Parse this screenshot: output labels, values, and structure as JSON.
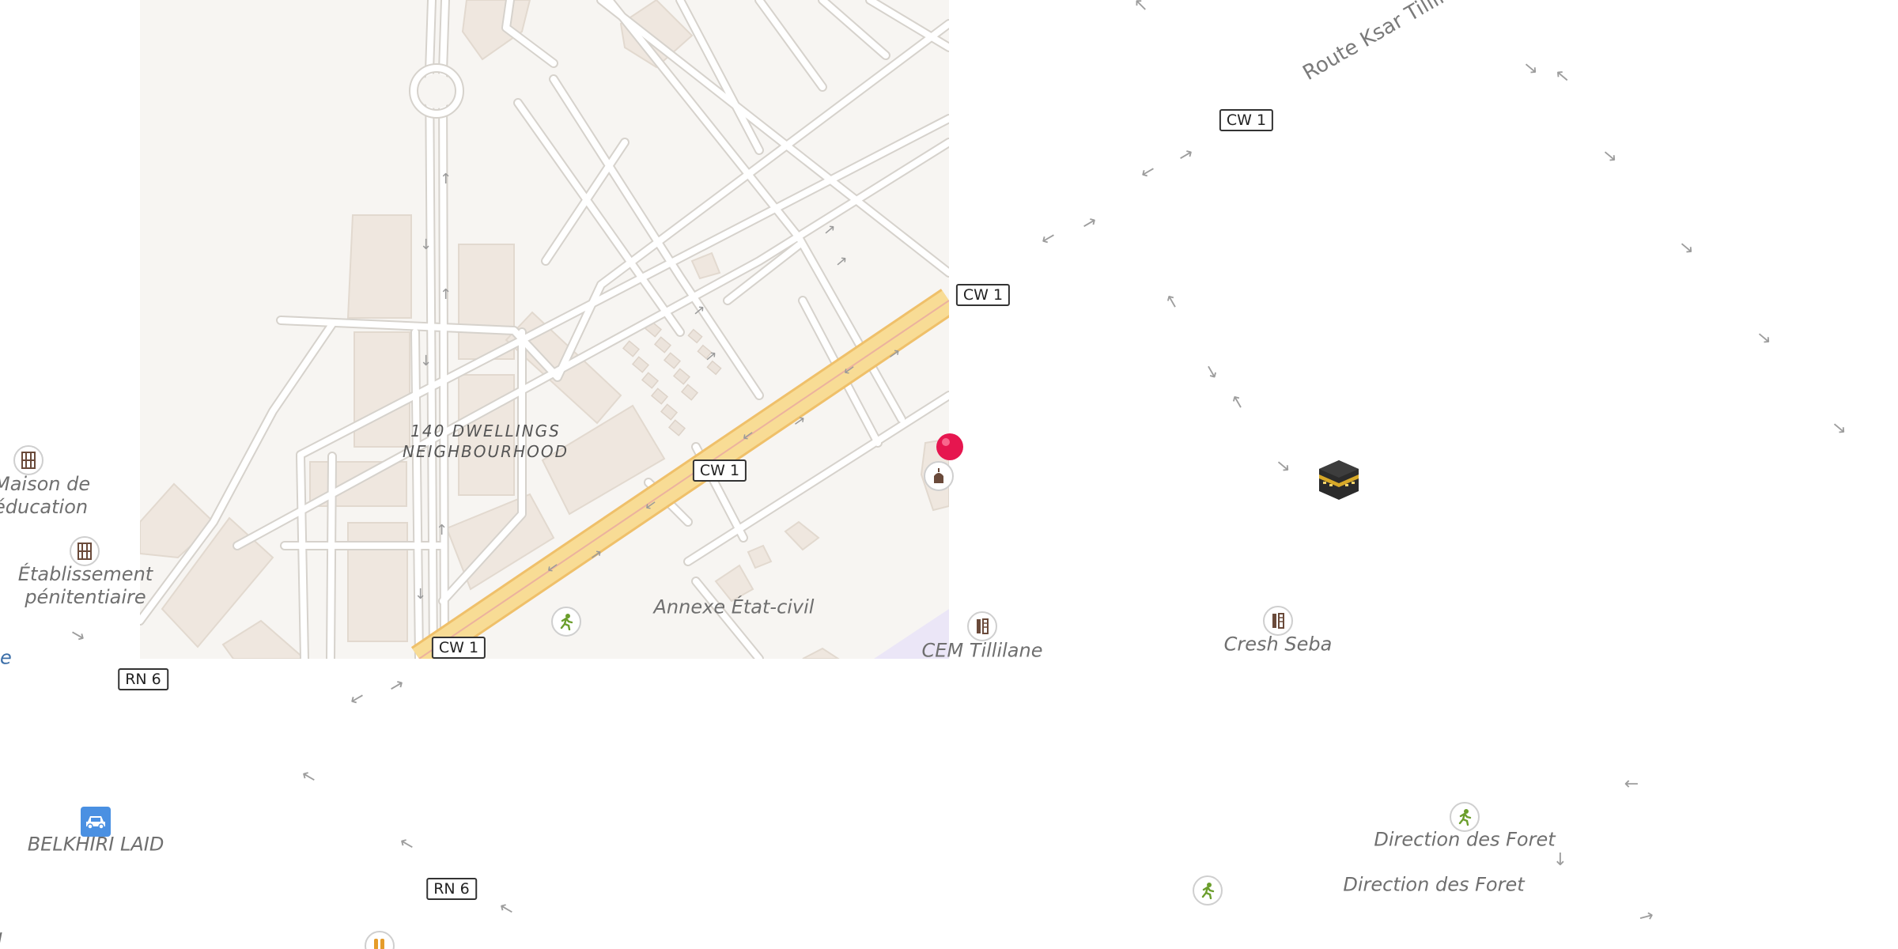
{
  "map": {
    "area_labels": {
      "neighbourhood_line1": "140 DWELLINGS",
      "neighbourhood_line2": "NEIGHBOURHOOD",
      "annexe": "Annexe État-civil",
      "maison_line1": "Maison de",
      "maison_line2": "éducation",
      "etab_line1": "Établissement",
      "etab_line2": "pénitentiaire",
      "cem": "CEM Tillilane",
      "cresh": "Cresh Seba",
      "belkhiri": "BELKHIRI LAID",
      "direction1": "Direction des Foret",
      "direction2": "Direction des Foret",
      "edge_text_e": "e",
      "edge_text_l": "l"
    },
    "road_name": "Route Ksar Tillilane",
    "shields": {
      "cw1_a": "CW 1",
      "cw1_b": "CW 1",
      "cw1_c": "CW 1",
      "cw1_d": "CW 1",
      "rn6_a": "RN 6",
      "rn6_b": "RN 6"
    },
    "colors": {
      "main_road_fill": "#f8dc95",
      "main_road_edge": "#efc06a",
      "building": "#efe7df",
      "street": "#ffffff",
      "street_casing": "#d8d4cf",
      "pin": "#e6164f",
      "car_poi": "#4a90e2",
      "sport_green": "#6b9e2c"
    },
    "icons": {
      "pin": "map-pin-icon",
      "kaaba": "kaaba-mosque-icon",
      "mosque": "mosque-icon",
      "school": "school-icon",
      "sport": "sport-icon",
      "car": "car-icon",
      "prison": "prison-icon",
      "fast_food": "fast-food-icon"
    }
  }
}
